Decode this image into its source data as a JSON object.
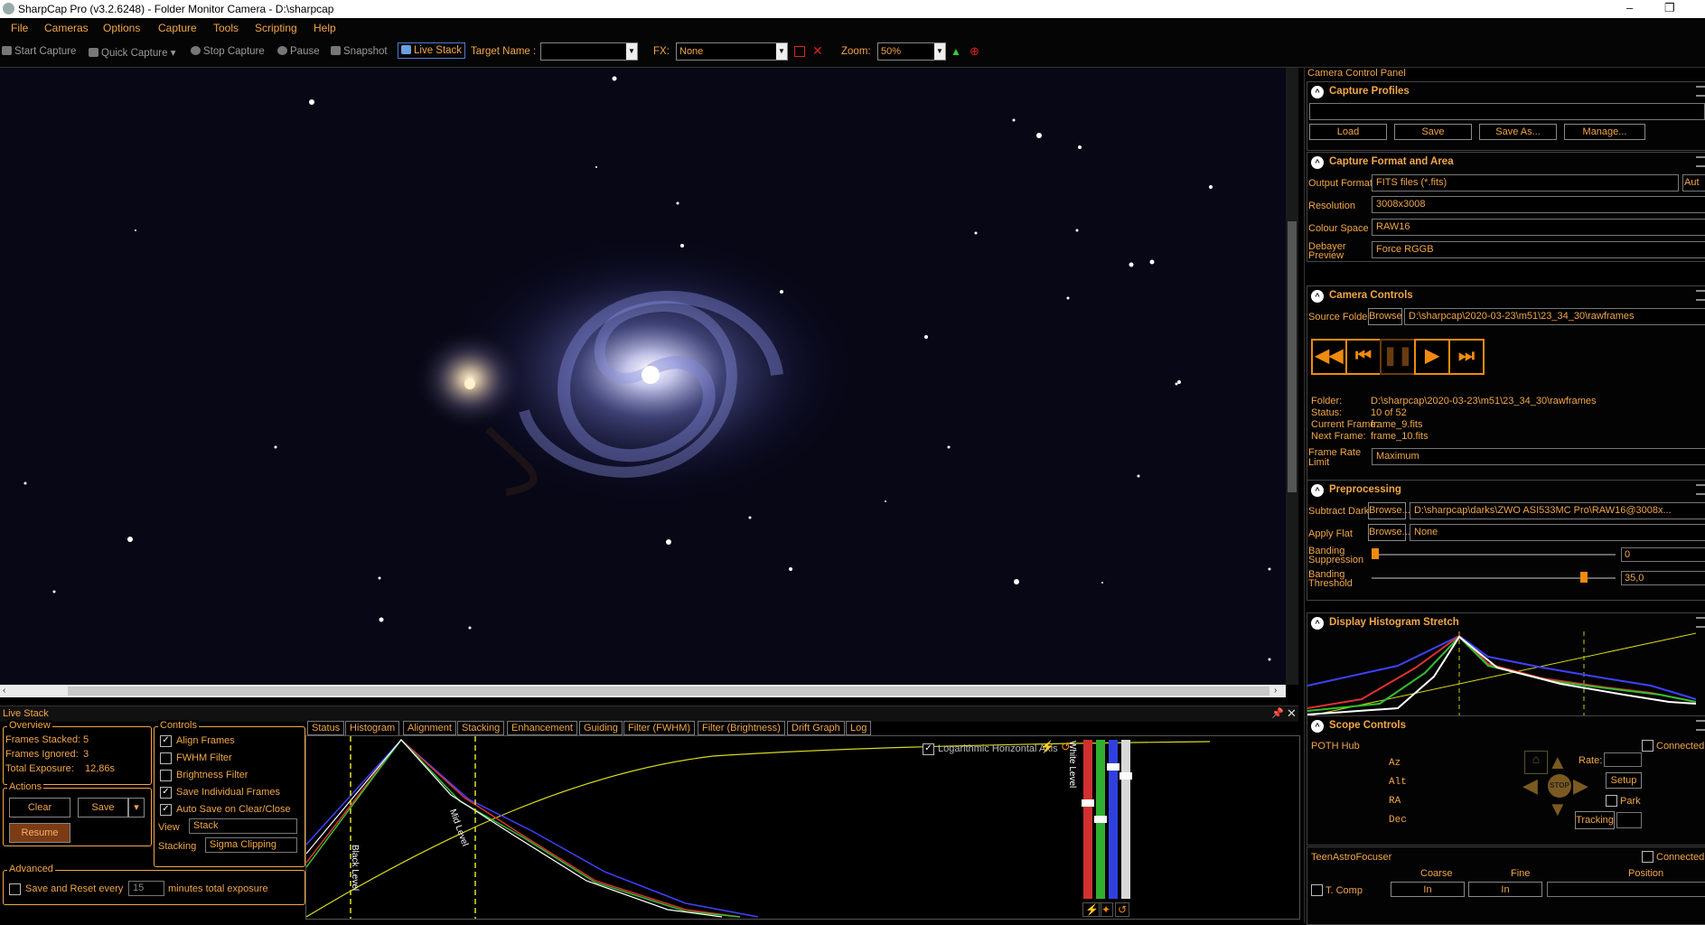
{
  "window": {
    "title": "SharpCap Pro (v3.2.6248) - Folder Monitor Camera - D:\\sharpcap",
    "minimize": "–",
    "maximize": "❐"
  },
  "menu": [
    "File",
    "Cameras",
    "Options",
    "Capture",
    "Tools",
    "Scripting",
    "Help"
  ],
  "toolbar": {
    "start_capture": "Start Capture",
    "quick_capture": "Quick Capture",
    "stop_capture": "Stop Capture",
    "pause": "Pause",
    "snapshot": "Snapshot",
    "live_stack": "Live Stack",
    "target_name_label": "Target Name :",
    "target_name_value": "",
    "fx_label": "FX:",
    "fx_value": "None",
    "zoom_label": "Zoom:",
    "zoom_value": "50%"
  },
  "right_panel": {
    "header": "Camera Control Panel",
    "capture_profiles": {
      "title": "Capture Profiles",
      "selected": "",
      "load": "Load",
      "save": "Save",
      "save_as": "Save As...",
      "manage": "Manage..."
    },
    "format_area": {
      "title": "Capture Format and Area",
      "output_format_label": "Output Format",
      "output_format": "FITS files (*.fits)",
      "output_format_extra": "Aut",
      "resolution_label": "Resolution",
      "resolution": "3008x3008",
      "colour_space_label": "Colour Space",
      "colour_space": "RAW16",
      "debayer_label_1": "Debayer",
      "debayer_label_2": "Preview",
      "debayer": "Force RGGB"
    },
    "camera_controls": {
      "title": "Camera Controls",
      "source_folder_label": "Source Folder",
      "browse": "Browse",
      "source_folder": "D:\\sharpcap\\2020-03-23\\m51\\23_34_30\\rawframes",
      "folder_label": "Folder:",
      "folder": "D:\\sharpcap\\2020-03-23\\m51\\23_34_30\\rawframes",
      "status_label": "Status:",
      "status": "10 of 52",
      "current_frame_label": "Current Frame:",
      "current_frame": "frame_9.fits",
      "next_frame_label": "Next Frame:",
      "next_frame": "frame_10.fits",
      "frame_rate_label_1": "Frame Rate",
      "frame_rate_label_2": "Limit",
      "frame_rate": "Maximum"
    },
    "preprocessing": {
      "title": "Preprocessing",
      "subtract_dark_label": "Subtract Dark",
      "browse": "Browse...",
      "subtract_dark": "D:\\sharpcap\\darks\\ZWO ASI533MC Pro\\RAW16@3008x...",
      "apply_flat_label": "Apply Flat",
      "apply_flat": "None",
      "banding_supp_label_1": "Banding",
      "banding_supp_label_2": "Suppression",
      "banding_supp_value": "0",
      "banding_thresh_label_1": "Banding",
      "banding_thresh_label_2": "Threshold",
      "banding_thresh_value": "35,0"
    },
    "display_stretch": {
      "title": "Display Histogram Stretch"
    },
    "scope": {
      "title": "Scope Controls",
      "hub": "POTH Hub",
      "connected": "Connected",
      "az": "Az",
      "alt": "Alt",
      "ra": "RA",
      "dec": "Dec",
      "rate_label": "Rate:",
      "setup": "Setup",
      "park": "Park",
      "tracking": "Tracking",
      "stop": "STOP"
    },
    "focuser": {
      "name": "TeenAstroFocuser",
      "connected": "Connected",
      "coarse": "Coarse",
      "fine": "Fine",
      "position": "Position",
      "tcomp": "T. Comp",
      "in_coarse": "In",
      "in_fine": "In"
    }
  },
  "live_stack": {
    "header": "Live Stack",
    "overview": {
      "title": "Overview",
      "frames_stacked_label": "Frames Stacked:",
      "frames_stacked": "5",
      "frames_ignored_label": "Frames Ignored:",
      "frames_ignored": "3",
      "total_exposure_label": "Total Exposure:",
      "total_exposure": "12,86s"
    },
    "actions": {
      "title": "Actions",
      "clear": "Clear",
      "save": "Save",
      "resume": "Resume"
    },
    "advanced": {
      "title": "Advanced",
      "save_reset": "Save and Reset every",
      "minutes_value": "15",
      "minutes_label": "minutes total exposure"
    },
    "controls": {
      "title": "Controls",
      "align_frames": "Align Frames",
      "fwhm_filter": "FWHM Filter",
      "brightness_filter": "Brightness Filter",
      "save_individual": "Save Individual Frames",
      "auto_save": "Auto Save on Clear/Close",
      "view_label": "View",
      "view": "Stack",
      "stacking_label": "Stacking",
      "stacking": "Sigma Clipping"
    },
    "tabs": [
      "Status",
      "Histogram",
      "Alignment",
      "Stacking",
      "Enhancement",
      "Guiding",
      "Filter (FWHM)",
      "Filter (Brightness)",
      "Drift Graph",
      "Log"
    ],
    "selected_tab": "Histogram",
    "histogram": {
      "log_axis_label": "Logarithmic Horizontal Axis",
      "black_level": "Black Level",
      "mid_level": "Mid Level",
      "white_level": "White Level"
    }
  },
  "colors": {
    "accent": "#f2a64a",
    "background": "#000000",
    "player": "#f08a10"
  }
}
